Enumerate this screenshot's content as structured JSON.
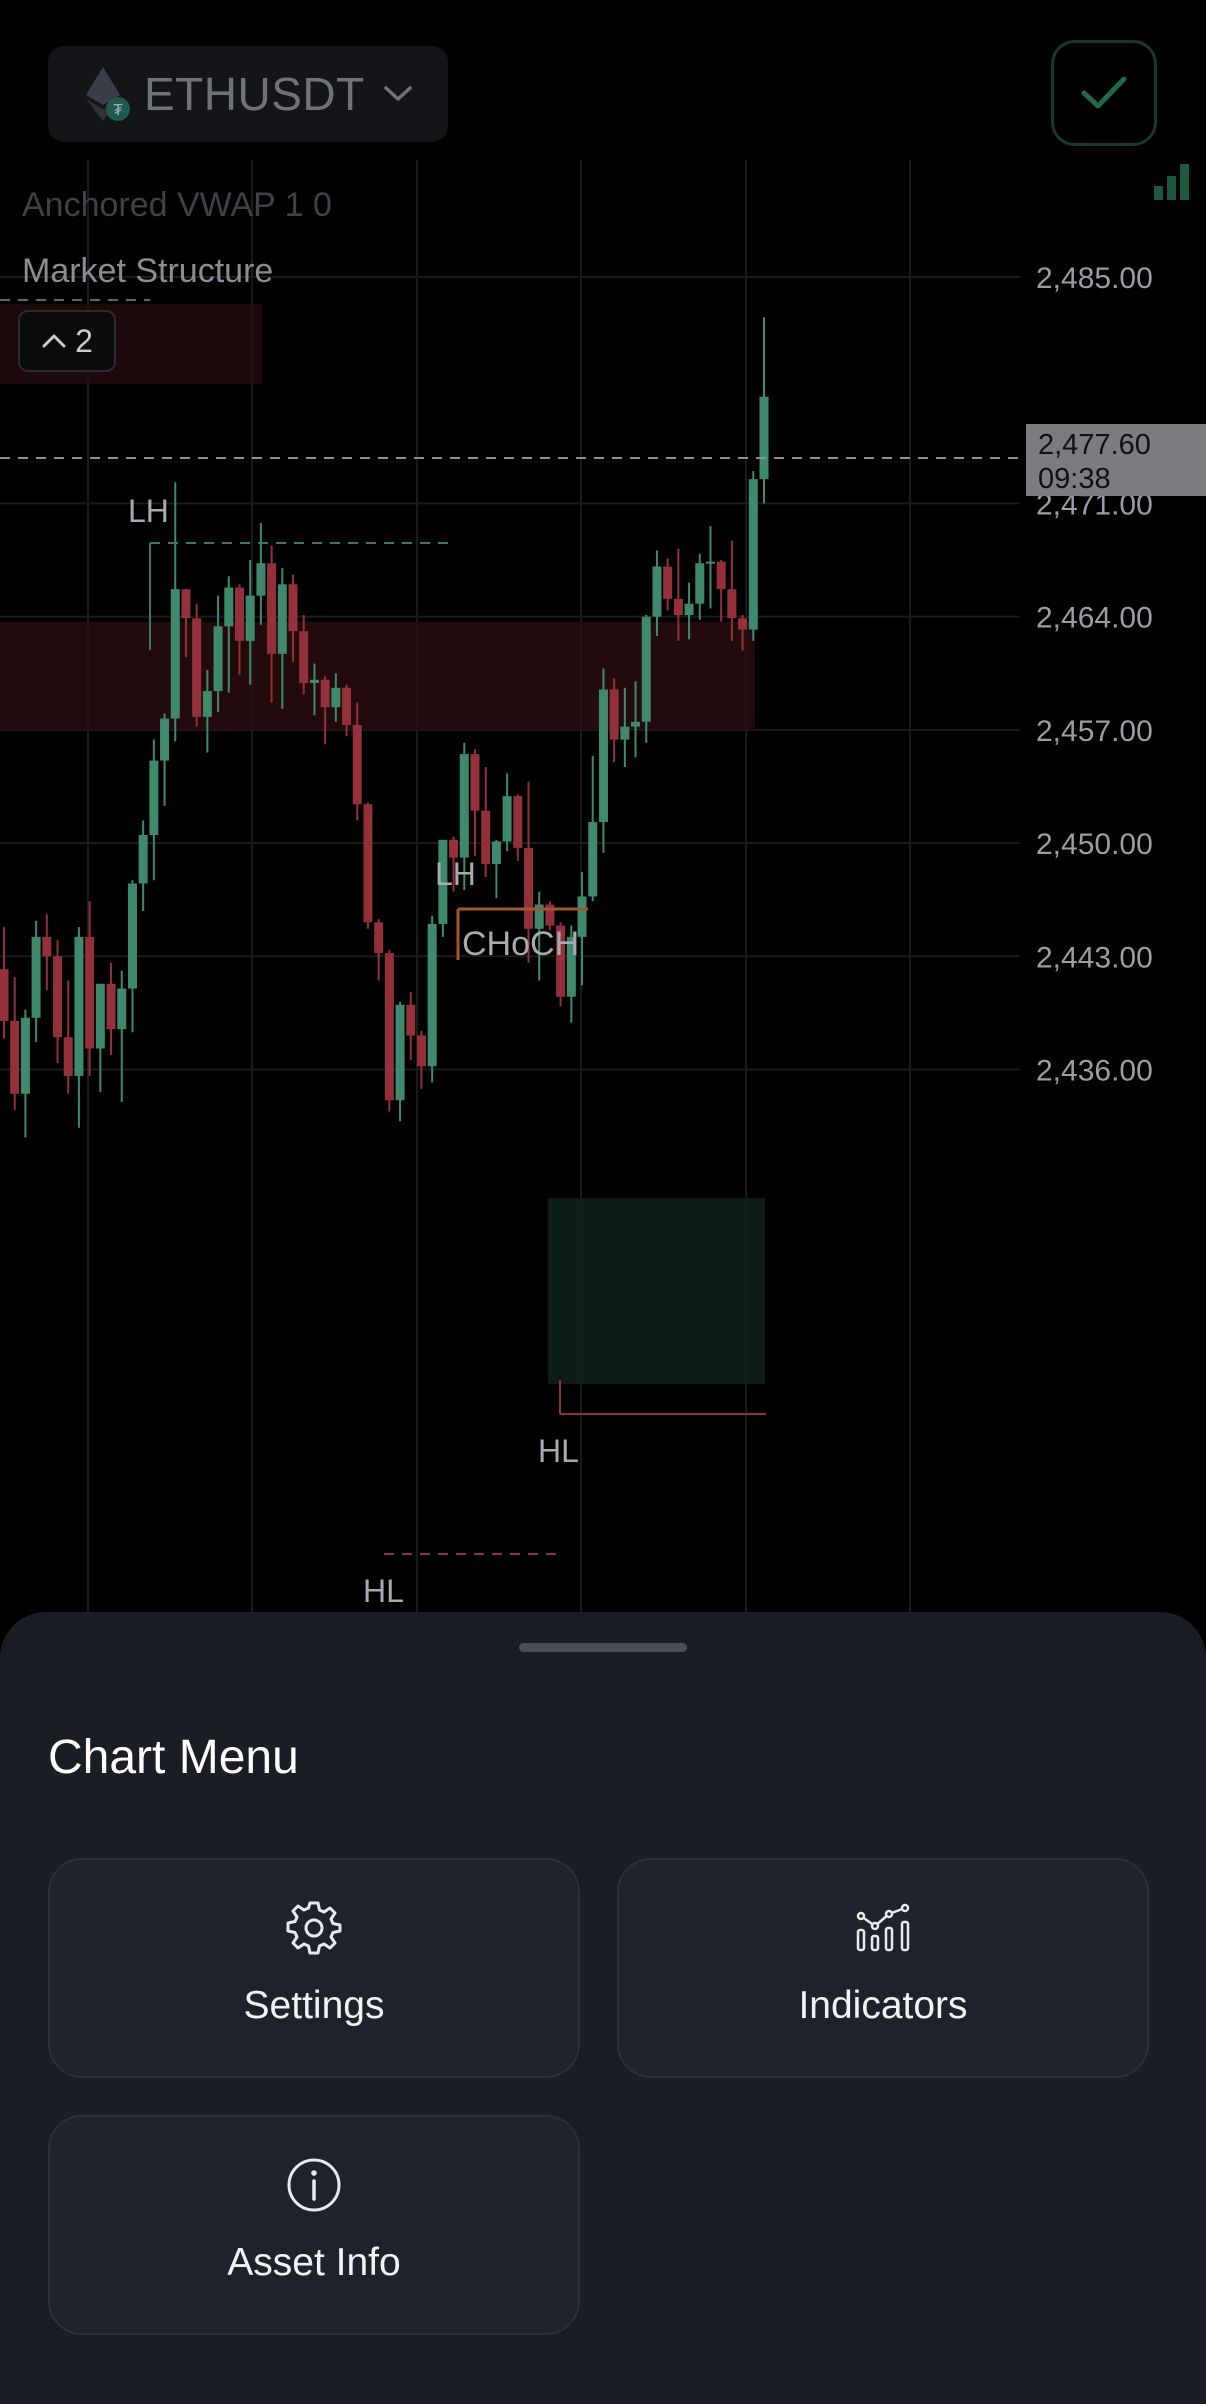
{
  "header": {
    "symbol": "ETHUSDT",
    "confirm_icon": "check-icon",
    "signal_icon": "signal-bars-icon"
  },
  "indicators": {
    "vwap_label": "Anchored VWAP 1 0",
    "structure_label": "Market Structure",
    "collapse_count": "2"
  },
  "chart_data": {
    "type": "candlestick",
    "price_axis": [
      "2,485.00",
      "2,471.00",
      "2,464.00",
      "2,457.00",
      "2,450.00",
      "2,443.00",
      "2,436.00"
    ],
    "last_price": {
      "value": "2,477.60",
      "countdown": "09:38"
    },
    "annotations": [
      "LH",
      "LH",
      "CHoCH",
      "HL",
      "HL"
    ],
    "candles": [
      [
        2442.2,
        2444.8,
        2437.9,
        2439.0
      ],
      [
        2439.0,
        2441.7,
        2433.5,
        2434.5
      ],
      [
        2434.5,
        2439.7,
        2431.8,
        2439.2
      ],
      [
        2439.2,
        2445.2,
        2437.7,
        2444.2
      ],
      [
        2444.2,
        2445.6,
        2440.9,
        2443.0
      ],
      [
        2443.0,
        2444.0,
        2436.4,
        2438.0
      ],
      [
        2438.0,
        2441.5,
        2434.5,
        2435.6
      ],
      [
        2435.6,
        2444.8,
        2432.4,
        2444.2
      ],
      [
        2444.2,
        2446.4,
        2435.6,
        2437.3
      ],
      [
        2437.3,
        2441.3,
        2434.6,
        2441.3
      ],
      [
        2441.3,
        2442.6,
        2436.9,
        2438.5
      ],
      [
        2438.5,
        2442.1,
        2434.0,
        2441.0
      ],
      [
        2441.0,
        2447.7,
        2438.3,
        2447.5
      ],
      [
        2447.5,
        2451.4,
        2445.8,
        2450.5
      ],
      [
        2450.5,
        2456.4,
        2447.7,
        2455.1
      ],
      [
        2455.1,
        2458.0,
        2452.3,
        2457.7
      ],
      [
        2457.7,
        2472.3,
        2456.3,
        2465.7
      ],
      [
        2465.7,
        2465.7,
        2461.5,
        2463.9
      ],
      [
        2463.9,
        2464.8,
        2457.2,
        2457.8
      ],
      [
        2457.8,
        2460.7,
        2455.6,
        2459.4
      ],
      [
        2459.4,
        2465.3,
        2458.1,
        2463.4
      ],
      [
        2463.4,
        2466.5,
        2459.3,
        2465.8
      ],
      [
        2465.8,
        2466.0,
        2460.4,
        2462.5
      ],
      [
        2462.5,
        2467.5,
        2459.8,
        2465.3
      ],
      [
        2465.3,
        2469.8,
        2463.5,
        2467.3
      ],
      [
        2467.3,
        2468.4,
        2458.7,
        2461.7
      ],
      [
        2461.7,
        2467.0,
        2458.3,
        2466.0
      ],
      [
        2466.0,
        2466.6,
        2461.2,
        2463.1
      ],
      [
        2463.1,
        2464.1,
        2459.2,
        2459.9
      ],
      [
        2459.9,
        2461.1,
        2457.9,
        2460.1
      ],
      [
        2460.1,
        2460.3,
        2456.1,
        2458.4
      ],
      [
        2458.4,
        2460.5,
        2457.5,
        2459.6
      ],
      [
        2459.6,
        2459.8,
        2456.6,
        2457.3
      ],
      [
        2457.3,
        2458.7,
        2451.4,
        2452.4
      ],
      [
        2452.4,
        2452.5,
        2444.7,
        2445.1
      ],
      [
        2445.1,
        2445.3,
        2441.5,
        2443.2
      ],
      [
        2443.2,
        2443.4,
        2433.4,
        2434.1
      ],
      [
        2434.1,
        2440.2,
        2432.8,
        2440.0
      ],
      [
        2440.0,
        2440.8,
        2436.6,
        2438.1
      ],
      [
        2438.1,
        2438.4,
        2434.8,
        2436.2
      ],
      [
        2436.2,
        2445.5,
        2435.2,
        2445.0
      ],
      [
        2445.0,
        2450.2,
        2444.2,
        2450.2
      ],
      [
        2450.2,
        2450.4,
        2447.0,
        2449.1
      ],
      [
        2449.1,
        2456.2,
        2447.1,
        2455.5
      ],
      [
        2455.5,
        2455.8,
        2449.2,
        2452.0
      ],
      [
        2452.0,
        2454.7,
        2447.9,
        2448.7
      ],
      [
        2448.7,
        2450.2,
        2446.6,
        2450.1
      ],
      [
        2450.1,
        2454.3,
        2449.5,
        2452.9
      ],
      [
        2452.9,
        2453.0,
        2448.9,
        2449.7
      ],
      [
        2449.7,
        2453.8,
        2442.6,
        2444.7
      ],
      [
        2444.7,
        2447.0,
        2441.5,
        2446.2
      ],
      [
        2446.2,
        2446.4,
        2444.6,
        2444.9
      ],
      [
        2444.9,
        2445.1,
        2439.9,
        2440.5
      ],
      [
        2440.5,
        2444.9,
        2438.9,
        2444.2
      ],
      [
        2444.2,
        2448.2,
        2441.2,
        2446.7
      ],
      [
        2446.7,
        2455.4,
        2446.4,
        2451.3
      ],
      [
        2451.3,
        2460.8,
        2449.4,
        2459.5
      ],
      [
        2459.5,
        2460.2,
        2455.0,
        2456.4
      ],
      [
        2456.4,
        2459.6,
        2454.7,
        2457.2
      ],
      [
        2457.2,
        2460.0,
        2455.3,
        2457.5
      ],
      [
        2457.5,
        2464.1,
        2456.2,
        2464.0
      ],
      [
        2464.0,
        2468.1,
        2462.8,
        2467.1
      ],
      [
        2467.1,
        2467.6,
        2464.4,
        2465.1
      ],
      [
        2465.1,
        2468.2,
        2462.5,
        2464.1
      ],
      [
        2464.1,
        2466.1,
        2462.6,
        2464.8
      ],
      [
        2464.8,
        2467.9,
        2463.8,
        2467.3
      ],
      [
        2467.3,
        2469.6,
        2464.5,
        2467.4
      ],
      [
        2467.4,
        2467.5,
        2463.7,
        2465.7
      ],
      [
        2465.7,
        2468.7,
        2462.5,
        2463.9
      ],
      [
        2463.9,
        2464.1,
        2461.9,
        2463.2
      ],
      [
        2463.2,
        2473.0,
        2462.5,
        2472.5
      ],
      [
        2472.5,
        2482.5,
        2471.0,
        2477.6
      ]
    ]
  },
  "menu": {
    "title": "Chart Menu",
    "items": [
      {
        "label": "Settings",
        "icon": "gear-icon"
      },
      {
        "label": "Indicators",
        "icon": "indicators-icon"
      },
      {
        "label": "Asset Info",
        "icon": "info-icon"
      }
    ]
  },
  "colors": {
    "background": "#000000",
    "sheet": "#1b1d24",
    "tile": "#1f222a",
    "bull": "#3f8a6d",
    "bear": "#93303a",
    "structure_orange": "#a0572e",
    "structure_line": "#3c7a5f"
  }
}
